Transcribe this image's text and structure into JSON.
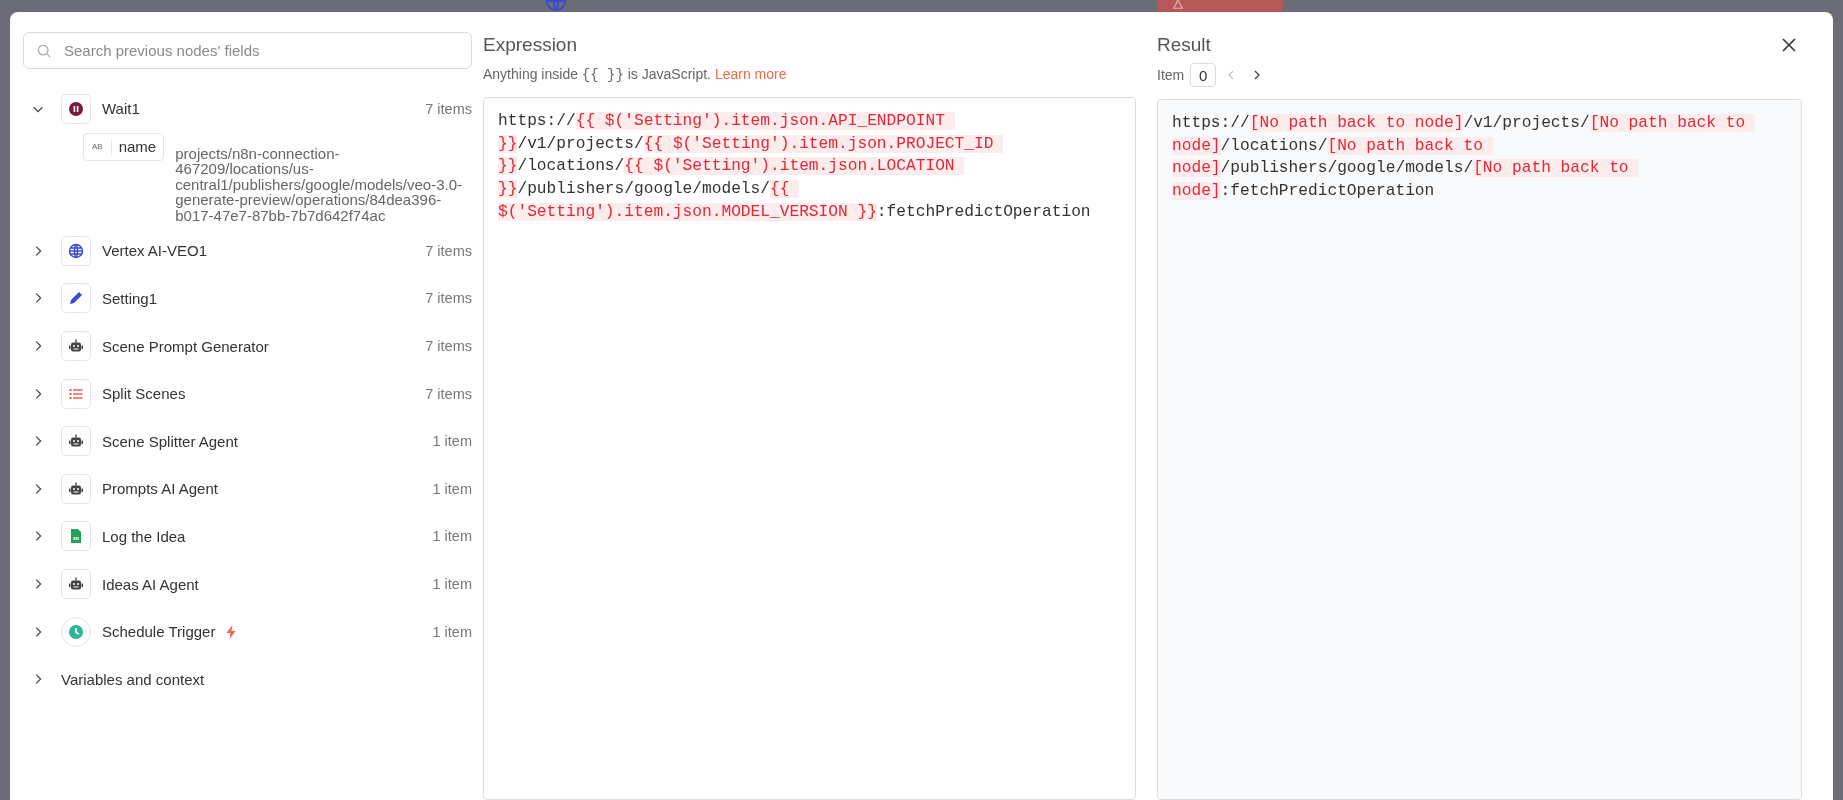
{
  "search": {
    "placeholder": "Search previous nodes' fields"
  },
  "tree": [
    {
      "label": "Wait1",
      "count": "7 items",
      "kind": "pause",
      "expanded": true,
      "children": [
        {
          "type": "AB",
          "name": "name",
          "value": "projects/n8n-connection-467209/locations/us-central1/publishers/google/models/veo-3.0-generate-preview/operations/84dea396-b017-47e7-87bb-7b7d642f74ac"
        }
      ]
    },
    {
      "label": "Vertex AI-VEO1",
      "count": "7 items",
      "kind": "globe",
      "expanded": false
    },
    {
      "label": "Setting1",
      "count": "7 items",
      "kind": "pencil",
      "expanded": false
    },
    {
      "label": "Scene Prompt Generator",
      "count": "7 items",
      "kind": "robot",
      "expanded": false
    },
    {
      "label": "Split Scenes",
      "count": "7 items",
      "kind": "list",
      "expanded": false
    },
    {
      "label": "Scene Splitter Agent",
      "count": "1 item",
      "kind": "robot",
      "expanded": false
    },
    {
      "label": "Prompts AI Agent",
      "count": "1 item",
      "kind": "robot",
      "expanded": false
    },
    {
      "label": "Log the Idea",
      "count": "1 item",
      "kind": "sheet",
      "expanded": false
    },
    {
      "label": "Ideas AI Agent",
      "count": "1 item",
      "kind": "robot",
      "expanded": false
    },
    {
      "label": "Schedule Trigger",
      "count": "1 item",
      "kind": "clock",
      "expanded": false,
      "trigger": true
    },
    {
      "label": "Variables and context",
      "expanded": false
    }
  ],
  "expression": {
    "title": "Expression",
    "hint_before": "Anything inside",
    "hint_braces": "{{ }}",
    "hint_after": "is JavaScript.",
    "link": "Learn more",
    "segments": [
      {
        "kind": "plain",
        "text": "https://"
      },
      {
        "kind": "expr",
        "text": "{{ $('Setting').item.json.API_ENDPOINT }}"
      },
      {
        "kind": "plain",
        "text": "/v1/projects/"
      },
      {
        "kind": "expr",
        "text": "{{ $('Setting').item.json.PROJECT_ID }}"
      },
      {
        "kind": "plain",
        "text": "/locations/"
      },
      {
        "kind": "expr",
        "text": "{{ $('Setting').item.json.LOCATION }}"
      },
      {
        "kind": "plain",
        "text": "/publishers/google/models/"
      },
      {
        "kind": "expr",
        "text": "{{ $('Setting').item.json.MODEL_VERSION }}"
      },
      {
        "kind": "plain",
        "text": ":fetchPredictOperation"
      }
    ]
  },
  "result": {
    "title": "Result",
    "item_label": "Item",
    "item_value": "0",
    "prev_disabled": true,
    "next_disabled": false,
    "segments": [
      {
        "kind": "plain",
        "text": "https://"
      },
      {
        "kind": "error",
        "text": "[No path back to node]"
      },
      {
        "kind": "plain",
        "text": "/v1/projects/"
      },
      {
        "kind": "error",
        "text": "[No path back to node]"
      },
      {
        "kind": "plain",
        "text": "/locations/"
      },
      {
        "kind": "error",
        "text": "[No path back to node]"
      },
      {
        "kind": "plain",
        "text": "/publishers/google/models/"
      },
      {
        "kind": "error",
        "text": "[No path back to node]"
      },
      {
        "kind": "plain",
        "text": ":fetchPredictOperation"
      }
    ]
  }
}
